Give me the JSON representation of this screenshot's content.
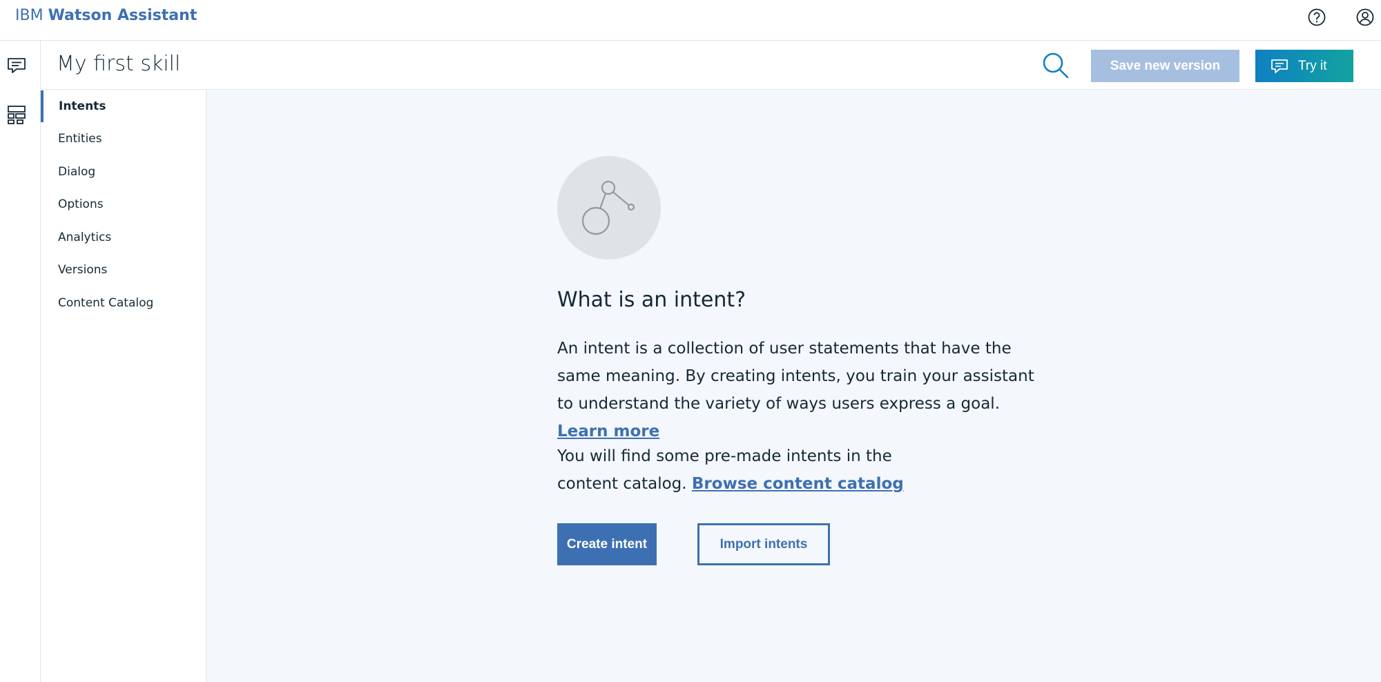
{
  "header": {
    "brand_prefix": "IBM",
    "brand_name": "Watson Assistant",
    "help_icon": "help-icon",
    "user_icon": "user-icon"
  },
  "rail": {
    "items": [
      {
        "icon": "chat-icon"
      },
      {
        "icon": "skills-icon"
      }
    ]
  },
  "skillbar": {
    "title": "My first skill",
    "search_icon": "search-icon",
    "save_label": "Save new version",
    "try_label": "Try it",
    "try_icon": "chat-bubble-icon",
    "overflow_icon": "overflow-menu-icon"
  },
  "sidebar": {
    "items": [
      {
        "label": "Intents",
        "active": true
      },
      {
        "label": "Entities"
      },
      {
        "label": "Dialog"
      },
      {
        "label": "Options"
      },
      {
        "label": "Analytics"
      },
      {
        "label": "Versions"
      },
      {
        "label": "Content Catalog"
      }
    ]
  },
  "main": {
    "illustration_icon": "intent-graph-icon",
    "title": "What is an intent?",
    "para1_text": "An intent is a collection of user statements that have the same meaning. By creating intents, you train your assistant to understand the variety of ways users express a goal.",
    "para1_link": "Learn more",
    "para2_text": "You will find some pre-made intents in the content catalog.",
    "para2_link": "Browse content catalog",
    "create_label": "Create intent",
    "import_label": "Import intents"
  },
  "colors": {
    "accent": "#3d70b2",
    "disabled": "#a6bfe0",
    "try_gradient_start": "#0f80c2",
    "try_gradient_end": "#12a3a0",
    "background": "#f4f7fb"
  }
}
